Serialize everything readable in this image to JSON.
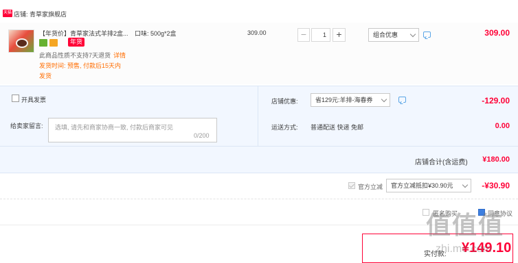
{
  "store": {
    "badge": "天猫",
    "label": "店铺: 青草家旗舰店"
  },
  "product": {
    "title": "【年货价】青草家法式羊排2盒...",
    "flavor": "口味: 500g*2盒",
    "tag": "年货",
    "no_return": "此商品性质不支持7天退货",
    "details_link": "详情",
    "ship_time": "发货时间: 预售, 付款后15天内",
    "ship_word": "发货",
    "unit_price": "309.00",
    "quantity": "1",
    "qty_minus": "−",
    "qty_plus": "+",
    "combo_select": "组合优惠",
    "row_total": "309.00"
  },
  "options": {
    "invoice_label": "开具发票",
    "message_label": "给卖家留言:",
    "message_placeholder": "选填, 请先和商家协商一致, 付款后商家可见",
    "message_count": "0/200",
    "shop_discount_label": "店铺优惠:",
    "coupon_select": "省129元:羊排-海春券",
    "coupon_amount": "-129.00",
    "shipping_label": "运送方式:",
    "shipping_value": "普通配送 快递 免邮",
    "shipping_cost": "0.00",
    "store_total_label": "店铺合计(含运费)",
    "store_total_value": "¥180.00"
  },
  "platform": {
    "label": "官方立减",
    "select": "官方立减抵扣¥30.90元",
    "amount": "-¥30.90"
  },
  "footer": {
    "anon_label": "匿名购买",
    "agree_label": "同意协议",
    "pay_label": "实付款:",
    "pay_amount": "¥149.10"
  },
  "watermark": {
    "logo": "值值值",
    "url": "zhi.me.com"
  },
  "colors": {
    "accent": "#ff0036",
    "orange": "#ff6d00",
    "panel": "#f2f7ff",
    "link_blue": "#5aa5e6"
  }
}
